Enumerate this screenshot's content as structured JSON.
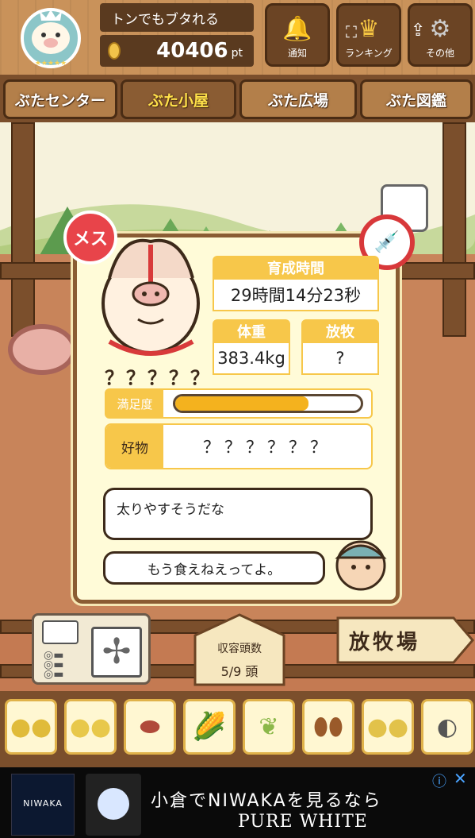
{
  "header": {
    "title": "トンでもブタれる",
    "points": "40406",
    "points_unit": "pt",
    "notify_label": "通知",
    "ranking_label": "ランキング",
    "other_label": "その他"
  },
  "tabs": [
    {
      "label": "ぶたセンター"
    },
    {
      "label": "ぶた小屋"
    },
    {
      "label": "ぶた広場"
    },
    {
      "label": "ぶた図鑑"
    }
  ],
  "pig": {
    "gender": "メス",
    "name": "？？？？？",
    "growth_label": "育成時間",
    "growth_value": "29時間14分23秒",
    "weight_label": "体重",
    "weight_value": "383.4kg",
    "grazing_label": "放牧",
    "grazing_value": "?",
    "satisfaction_label": "満足度",
    "satisfaction": 0.72,
    "favorite_label": "好物",
    "favorite_value": "？？？？？？",
    "speech_pig": "太りやすそうだな",
    "speech_farmer": "もう食えねえってよ。"
  },
  "barn": {
    "capacity_label": "収容頭数",
    "capacity_value": "5/9 頭"
  },
  "field_sign": "放牧場",
  "ad": {
    "brand": "NIWAKA",
    "headline": "小倉でNIWAKAを見るなら",
    "sub": "PURE WHITE"
  },
  "colors": {
    "wood": "#7b4f2c",
    "card_bg": "#fffbd8",
    "label_yellow": "#f7c74a",
    "female_red": "#e8444a"
  }
}
